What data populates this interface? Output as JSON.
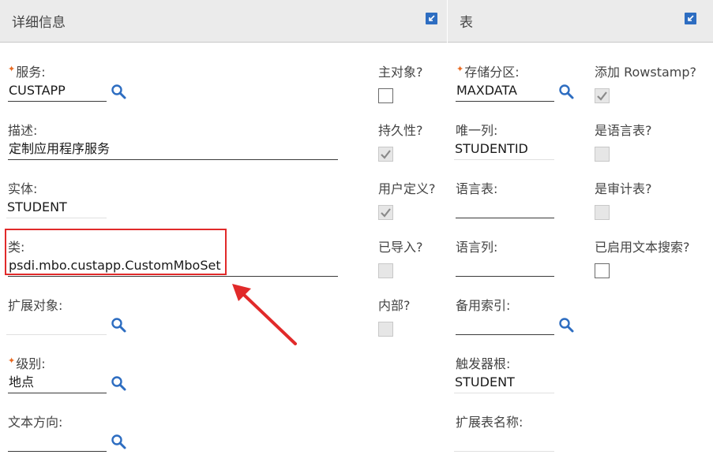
{
  "left_panel": {
    "title": "详细信息",
    "fields": {
      "service": {
        "label": "服务:",
        "value": "CUSTAPP"
      },
      "description": {
        "label": "描述:",
        "value": "定制应用程序服务"
      },
      "entity": {
        "label": "实体:",
        "value": "STUDENT"
      },
      "class": {
        "label": "类:",
        "value": "psdi.mbo.custapp.CustomMboSet"
      },
      "ext_object": {
        "label": "扩展对象:",
        "value": ""
      },
      "level": {
        "label": "级别:",
        "value": "地点"
      },
      "text_direction": {
        "label": "文本方向:",
        "value": ""
      }
    },
    "checkboxes": {
      "main_object": {
        "label": "主对象?",
        "checked": false
      },
      "persistent": {
        "label": "持久性?",
        "checked": true
      },
      "user_defined": {
        "label": "用户定义?",
        "checked": true
      },
      "imported": {
        "label": "已导入?",
        "checked": false
      },
      "internal": {
        "label": "内部?",
        "checked": false
      }
    }
  },
  "right_panel": {
    "title": "表",
    "fields": {
      "storage_partition": {
        "label": "存储分区:",
        "value": "MAXDATA"
      },
      "unique_column": {
        "label": "唯一列:",
        "value": "STUDENTID"
      },
      "language_table": {
        "label": "语言表:",
        "value": ""
      },
      "language_column": {
        "label": "语言列:",
        "value": ""
      },
      "alt_index": {
        "label": "备用索引:",
        "value": ""
      },
      "trigger_root": {
        "label": "触发器根:",
        "value": "STUDENT"
      },
      "ext_table_name": {
        "label": "扩展表名称:",
        "value": ""
      }
    },
    "checkboxes": {
      "add_rowstamp": {
        "label": "添加 Rowstamp?",
        "checked": true
      },
      "is_language_table": {
        "label": "是语言表?",
        "checked": false
      },
      "is_audit_table": {
        "label": "是审计表?",
        "checked": false
      },
      "text_search_enabled": {
        "label": "已启用文本搜索?",
        "checked": false
      }
    }
  },
  "annotation": {
    "highlight_color": "#e12a2a"
  },
  "colors": {
    "accent": "#2d6dc1",
    "required": "#e86a22",
    "header_bg": "#ebebeb"
  },
  "icons": {
    "search": "search-icon",
    "collapse": "collapse-icon",
    "check": "check-icon"
  }
}
